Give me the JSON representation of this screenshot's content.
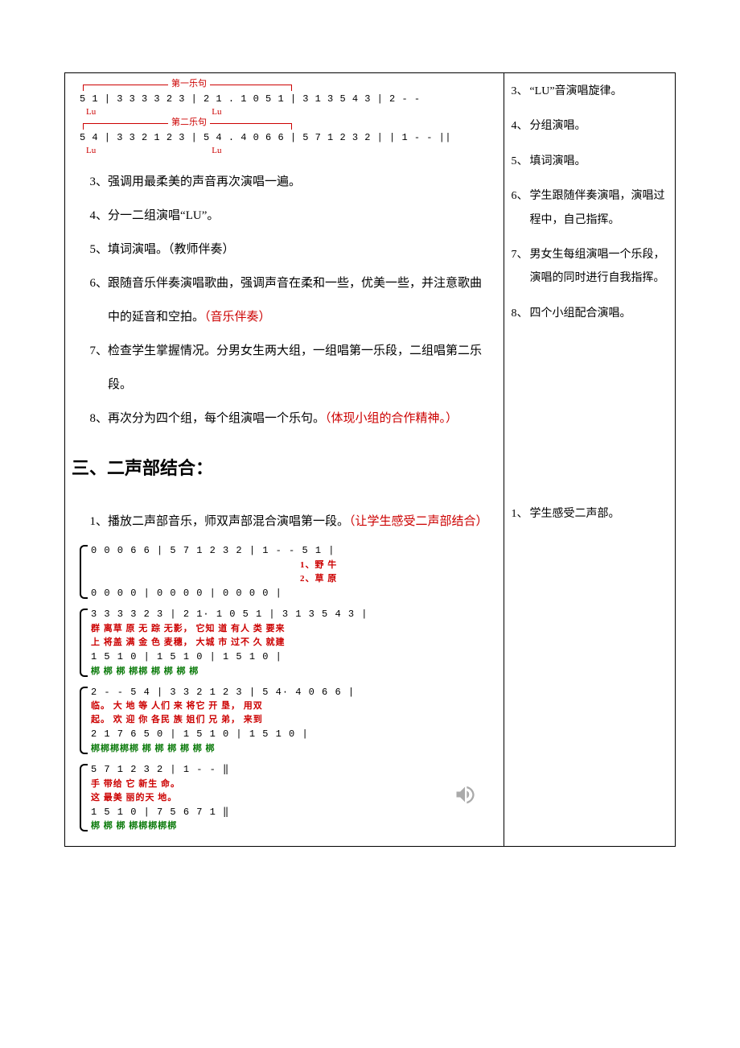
{
  "music_phrases": {
    "phrase1_label": "第一乐句",
    "phrase2_label": "第二乐句",
    "line1_notation": "5 1 | 3 3 3 3 2 3 | 2 1 . 1 0 5 1 | 3 1 3 5 4 3 | 2 - -",
    "line1_lu_left": "Lu",
    "line1_lu_right": "Lu",
    "line2_notation": "5 4 | 3 3 2 1 2 3 | 5 4 . 4 0 6 6 | 5 7 1 2 3 2 | | 1 - - ||",
    "line2_lu_left": "Lu",
    "line2_lu_right": "Lu"
  },
  "left_items": {
    "item3": "强调用最柔美的声音再次演唱一遍。",
    "item4_a": "分一二组演唱“",
    "item4_b": "LU",
    "item4_c": "”。",
    "item5_a": "填词演唱。（教师伴奏）",
    "item6_a": "跟随音乐伴奏演唱歌曲，强调声音在柔和一些，优美一些，并注意歌曲中的延音和空拍。",
    "item6_red": "（音乐伴奏）",
    "item7_a": "检查学生掌握情况。分男女生两大组，一组唱第一乐段，二组唱第二乐段。",
    "item8_a": "再次分为四个组，每个组演唱一个乐句。",
    "item8_red": "（体现小组的合作精神。）"
  },
  "section3_heading": "三、二声部结合：",
  "section3_item1_a": "播放二声部音乐，师双声部混合演唱第一段。",
  "section3_item1_red": "（让学生感受二声部结合）",
  "right_items": {
    "r3": "“LU”音演唱旋律。",
    "r4": "分组演唱。",
    "r5": "填词演唱。",
    "r6": "学生跟随伴奏演唱，演唱过程中，自己指挥。",
    "r7": "男女生每组演唱一个乐段，演唱的同时进行自我指挥。",
    "r8": "四个小组配合演唱。",
    "s1": "学生感受二声部。"
  },
  "score": {
    "sys1": {
      "top": "0  0  0  6 6 |  5  7 1  2  3 2 |  1 - -   5  1  |",
      "lyric1": "                                      1、野 牛",
      "lyric2": "                                      2、草 原",
      "bot": "0  0  0  0   |  0 0    0 0    |  0 0 0   0     |"
    },
    "sys2": {
      "top": "3  3 3  3  2 3 | 2 1·   1 0  5 1 |  3  1 3  5  4 3 |",
      "lyr1": "群 离草 原 无 踪   无影，         它知   道 有人 类 要来",
      "lyr2": "上 将盖 满 金 色   麦穗，         大城   市 过不 久 就建",
      "bot": "1  5    1  0   | 1 5   1   0    |  1  5   1   0   |",
      "botlyr": "梆 梆      梆       梆梆  梆          梆 梆  梆"
    },
    "sys3": {
      "top": "2  - -  5 4  | 3  3 2  1  2 3 | 5  4·  4 0  6 6 |",
      "lyr1": "临。      大 地   等 人们 来  将它   开 垦，      用双",
      "lyr2": "起。      欢 迎   你 各民 族  姐们   兄 弟，      来到",
      "bot": "2 1 7 6 5  0   | 1  5   1   0   | 1  5   1   0    |",
      "botlyr": "梆梆梆梆梆        梆 梆  梆        梆 梆  梆"
    },
    "sys4": {
      "top": "5  7 1  2  3 2 | 1  -  -        ‖",
      "lyr1": "手 带给 它 新生   命。",
      "lyr2": "这 最美  丽的天   地。",
      "bot": "1  5   1   0   | 7 5 6 7 1      ‖",
      "botlyr": "梆 梆  梆        梆梆梆梆梆"
    }
  },
  "nums": {
    "n3": "3、",
    "n4": "4、",
    "n5": "5、",
    "n6": "6、",
    "n7": "7、",
    "n8": "8、",
    "n1": "1、"
  }
}
